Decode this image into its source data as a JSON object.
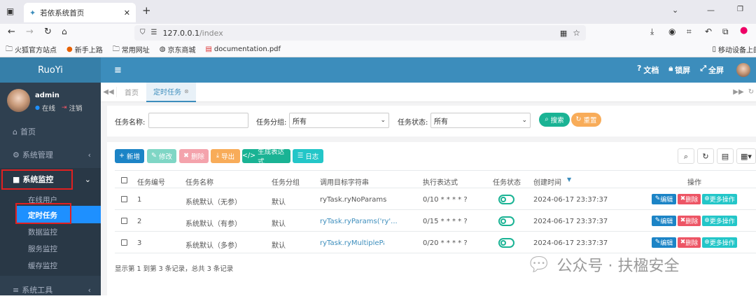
{
  "browser": {
    "tab_title": "若依系统首页",
    "url_host": "127.0.0.1",
    "url_path": "/index",
    "bookmarks": [
      "火狐官方站点",
      "新手上路",
      "常用网址",
      "京东商城",
      "documentation.pdf"
    ],
    "mobile_bookmark": "移动设备上的"
  },
  "app": {
    "logo": "RuoYi",
    "topnav": {
      "docs": "文档",
      "lock": "锁屏",
      "fullscreen": "全屏"
    },
    "user": {
      "name": "admin",
      "status": "在线",
      "logout": "注销"
    },
    "menu": {
      "home": "首页",
      "system_mgmt": "系统管理",
      "system_monitor": "系统监控",
      "sub": [
        "在线用户",
        "定时任务",
        "数据监控",
        "服务监控",
        "缓存监控"
      ],
      "system_tools": "系统工具"
    },
    "tabs": {
      "home": "首页",
      "active": "定时任务"
    },
    "search": {
      "name_label": "任务名称:",
      "group_label": "任务分组:",
      "group_value": "所有",
      "status_label": "任务状态:",
      "status_value": "所有",
      "search_btn": "搜索",
      "reset_btn": "重置"
    },
    "actions": {
      "add": "新增",
      "edit": "修改",
      "delete": "删除",
      "export": "导出",
      "cron": "生成表达式",
      "log": "日志"
    },
    "table": {
      "headers": [
        "任务编号",
        "任务名称",
        "任务分组",
        "调用目标字符串",
        "执行表达式",
        "任务状态",
        "创建时间",
        "操作"
      ],
      "rows": [
        {
          "id": "1",
          "name": "系统默认（无参）",
          "group": "默认",
          "target": "ryTask.ryNoParams",
          "cron": "0/10 * * * * ?",
          "created": "2024-06-17 23:37:37"
        },
        {
          "id": "2",
          "name": "系统默认（有参）",
          "group": "默认",
          "target": "ryTask.ryParams('ry'...",
          "cron": "0/15 * * * * ?",
          "created": "2024-06-17 23:37:37"
        },
        {
          "id": "3",
          "name": "系统默认（多参）",
          "group": "默认",
          "target": "ryTask.ryMultipleParams...",
          "cron": "0/20 * * * * ?",
          "created": "2024-06-17 23:37:37"
        }
      ],
      "row_actions": {
        "edit": "编辑",
        "delete": "删除",
        "more": "更多操作"
      },
      "footer": "显示第 1 到第 3 条记录，总共 3 条记录"
    },
    "watermark": "公众号 · 扶楹安全"
  },
  "colors": {
    "sidebar": "#2f4050",
    "topbar": "#3c8dbc",
    "active_menu": "#1e90ff",
    "highlight_box": "#e02020"
  }
}
